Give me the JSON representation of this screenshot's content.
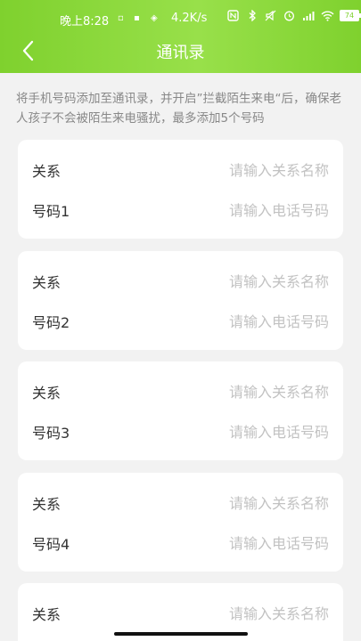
{
  "status": {
    "time": "晚上8:28",
    "dot1": "▫",
    "dot2": "▪",
    "dot3": "◈",
    "speed": "4.2K/s",
    "battery": "74"
  },
  "header": {
    "title": "通讯录"
  },
  "intro": "将手机号码添加至通讯录，并开启”拦截陌生来电“后，确保老人孩子不会被陌生来电骚扰，最多添加5个号码",
  "contacts": [
    {
      "relation_label": "关系",
      "relation_placeholder": "请输入关系名称",
      "phone_label": "号码1",
      "phone_placeholder": "请输入电话号码"
    },
    {
      "relation_label": "关系",
      "relation_placeholder": "请输入关系名称",
      "phone_label": "号码2",
      "phone_placeholder": "请输入电话号码"
    },
    {
      "relation_label": "关系",
      "relation_placeholder": "请输入关系名称",
      "phone_label": "号码3",
      "phone_placeholder": "请输入电话号码"
    },
    {
      "relation_label": "关系",
      "relation_placeholder": "请输入关系名称",
      "phone_label": "号码4",
      "phone_placeholder": "请输入电话号码"
    },
    {
      "relation_label": "关系",
      "relation_placeholder": "请输入关系名称"
    }
  ],
  "colors": {
    "accent": "#7fd12e",
    "background": "#f2f2f2"
  }
}
